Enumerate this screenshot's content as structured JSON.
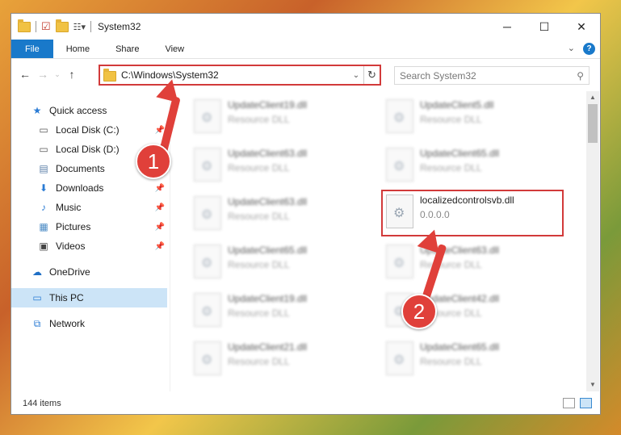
{
  "window": {
    "title": "System32"
  },
  "ribbon": {
    "tabs": [
      "File",
      "Home",
      "Share",
      "View"
    ]
  },
  "nav": {
    "address_path": "C:\\Windows\\System32",
    "search_placeholder": "Search System32"
  },
  "sidebar": {
    "items": [
      {
        "label": "Quick access",
        "icon": "star-icon",
        "pinned": false
      },
      {
        "label": "Local Disk (C:)",
        "icon": "drive-icon",
        "pinned": true
      },
      {
        "label": "Local Disk (D:)",
        "icon": "drive-icon",
        "pinned": true
      },
      {
        "label": "Documents",
        "icon": "documents-icon",
        "pinned": true
      },
      {
        "label": "Downloads",
        "icon": "download-icon",
        "pinned": true
      },
      {
        "label": "Music",
        "icon": "music-icon",
        "pinned": true
      },
      {
        "label": "Pictures",
        "icon": "pictures-icon",
        "pinned": true
      },
      {
        "label": "Videos",
        "icon": "video-icon",
        "pinned": true
      },
      {
        "label": "OneDrive",
        "icon": "cloud-icon",
        "pinned": false
      },
      {
        "label": "This PC",
        "icon": "computer-icon",
        "pinned": false
      },
      {
        "label": "Network",
        "icon": "network-icon",
        "pinned": false
      }
    ]
  },
  "files": {
    "left": [
      {
        "name": "UpdateClient19.dll",
        "sub": "Resource DLL"
      },
      {
        "name": "UpdateClient63.dll",
        "sub": "Resource DLL"
      },
      {
        "name": "UpdateClient63.dll",
        "sub": "Resource DLL"
      },
      {
        "name": "UpdateClient65.dll",
        "sub": "Resource DLL"
      },
      {
        "name": "UpdateClient19.dll",
        "sub": "Resource DLL"
      },
      {
        "name": "UpdateClient21.dll",
        "sub": "Resource DLL"
      }
    ],
    "right": [
      {
        "name": "UpdateClient5.dll",
        "sub": "Resource DLL"
      },
      {
        "name": "UpdateClient65.dll",
        "sub": "Resource DLL"
      },
      {
        "name": "localizedcontrolsvb.dll",
        "sub": "0.0.0.0"
      },
      {
        "name": "UpdateClient63.dll",
        "sub": "Resource DLL"
      },
      {
        "name": "UpdateClient42.dll",
        "sub": "Resource DLL"
      },
      {
        "name": "UpdateClient65.dll",
        "sub": "Resource DLL"
      }
    ]
  },
  "status": {
    "items_count": "144 items"
  },
  "annotations": {
    "badge1": "1",
    "badge2": "2"
  },
  "colors": {
    "accent": "#1979ca",
    "annotation": "#e0403a",
    "selected": "#cce4f7"
  }
}
